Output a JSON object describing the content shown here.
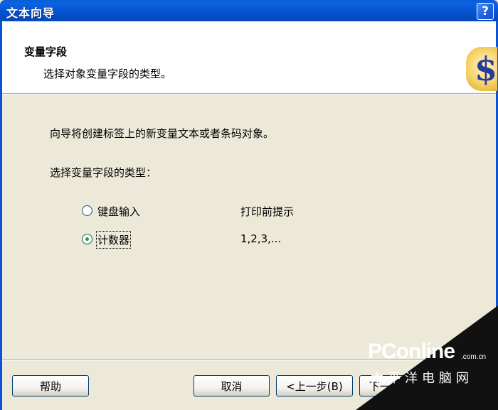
{
  "window": {
    "title": "文本向导",
    "help_glyph": "?"
  },
  "header": {
    "title": "变量字段",
    "subtitle": "选择对象变量字段的类型。",
    "icon": "dollar-icon",
    "icon_glyph": "$"
  },
  "body": {
    "intro": "向导将创建标签上的新变量文本或者条码对象。",
    "prompt": "选择变量字段的类型：",
    "options": [
      {
        "label": "键盘输入",
        "description": "打印前提示",
        "selected": false
      },
      {
        "label": "计数器",
        "description": "1,2,3,...",
        "selected": true
      }
    ]
  },
  "buttons": {
    "help": "帮助",
    "cancel": "取消",
    "back": "<上一步(B)",
    "next": "下一步(N)>"
  },
  "watermark": {
    "logo": "PConline",
    "domain": ".com.cn",
    "tagline": "太平洋电脑网"
  },
  "colors": {
    "titlebar": "#0553cf",
    "dialog_bg": "#ece9d8",
    "radio_dot": "#21a121"
  }
}
